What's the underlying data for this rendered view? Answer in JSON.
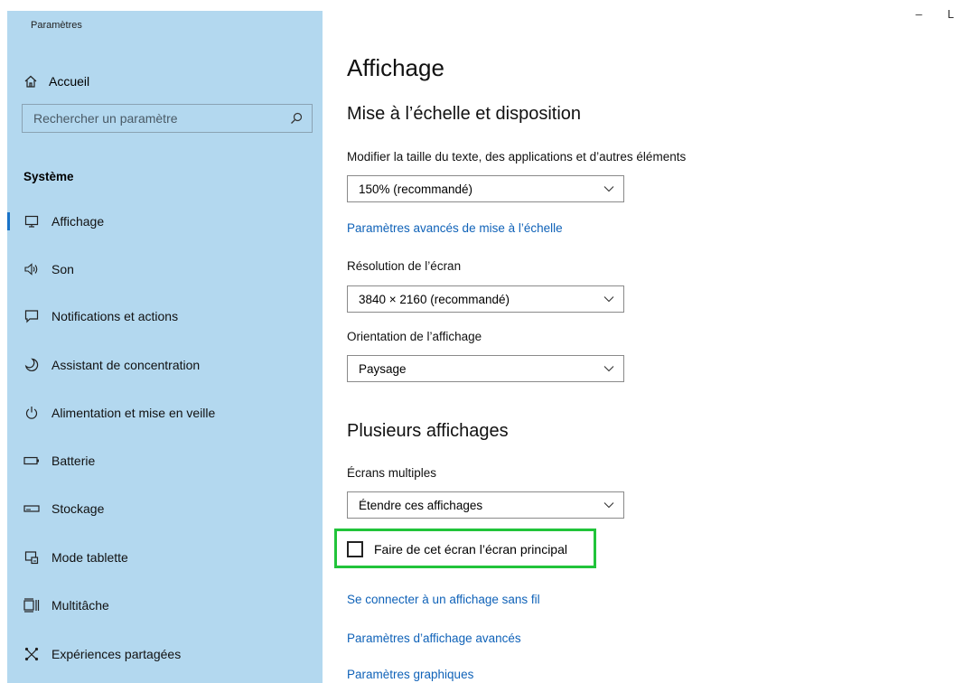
{
  "window": {
    "title": "Paramètres",
    "minimize": "–",
    "maximize": "L"
  },
  "sidebar": {
    "home_label": "Accueil",
    "search_placeholder": "Rechercher un paramètre",
    "section_title": "Système",
    "items": [
      {
        "label": "Affichage",
        "icon": "monitor-icon",
        "active": true
      },
      {
        "label": "Son",
        "icon": "speaker-icon"
      },
      {
        "label": "Notifications et actions",
        "icon": "notification-icon"
      },
      {
        "label": "Assistant de concentration",
        "icon": "moon-icon"
      },
      {
        "label": "Alimentation et mise en veille",
        "icon": "power-icon"
      },
      {
        "label": "Batterie",
        "icon": "battery-icon"
      },
      {
        "label": "Stockage",
        "icon": "storage-icon"
      },
      {
        "label": "Mode tablette",
        "icon": "tablet-mode-icon"
      },
      {
        "label": "Multitâche",
        "icon": "multitask-icon"
      },
      {
        "label": "Expériences partagées",
        "icon": "shared-experiences-icon"
      }
    ]
  },
  "main": {
    "title": "Affichage",
    "scale_section": {
      "heading": "Mise à l’échelle et disposition",
      "text_size_label": "Modifier la taille du texte, des applications et d’autres éléments",
      "text_size_value": "150% (recommandé)",
      "advanced_scaling_link": "Paramètres avancés de mise à l’échelle",
      "resolution_label": "Résolution de l’écran",
      "resolution_value": "3840 × 2160 (recommandé)",
      "orientation_label": "Orientation de l’affichage",
      "orientation_value": "Paysage"
    },
    "multi_section": {
      "heading": "Plusieurs affichages",
      "multi_label": "Écrans multiples",
      "multi_value": "Étendre ces affichages",
      "main_display_checkbox": "Faire de cet écran l’écran principal",
      "main_display_checked": false,
      "wireless_link": "Se connecter à un affichage sans fil",
      "advanced_display_link": "Paramètres d’affichage avancés",
      "graphics_link": "Paramètres graphiques"
    }
  },
  "colors": {
    "sidebar_bg": "#b3d8ef",
    "accent": "#1a73c8",
    "link": "#0f62b8",
    "highlight_box": "#21c43a"
  }
}
